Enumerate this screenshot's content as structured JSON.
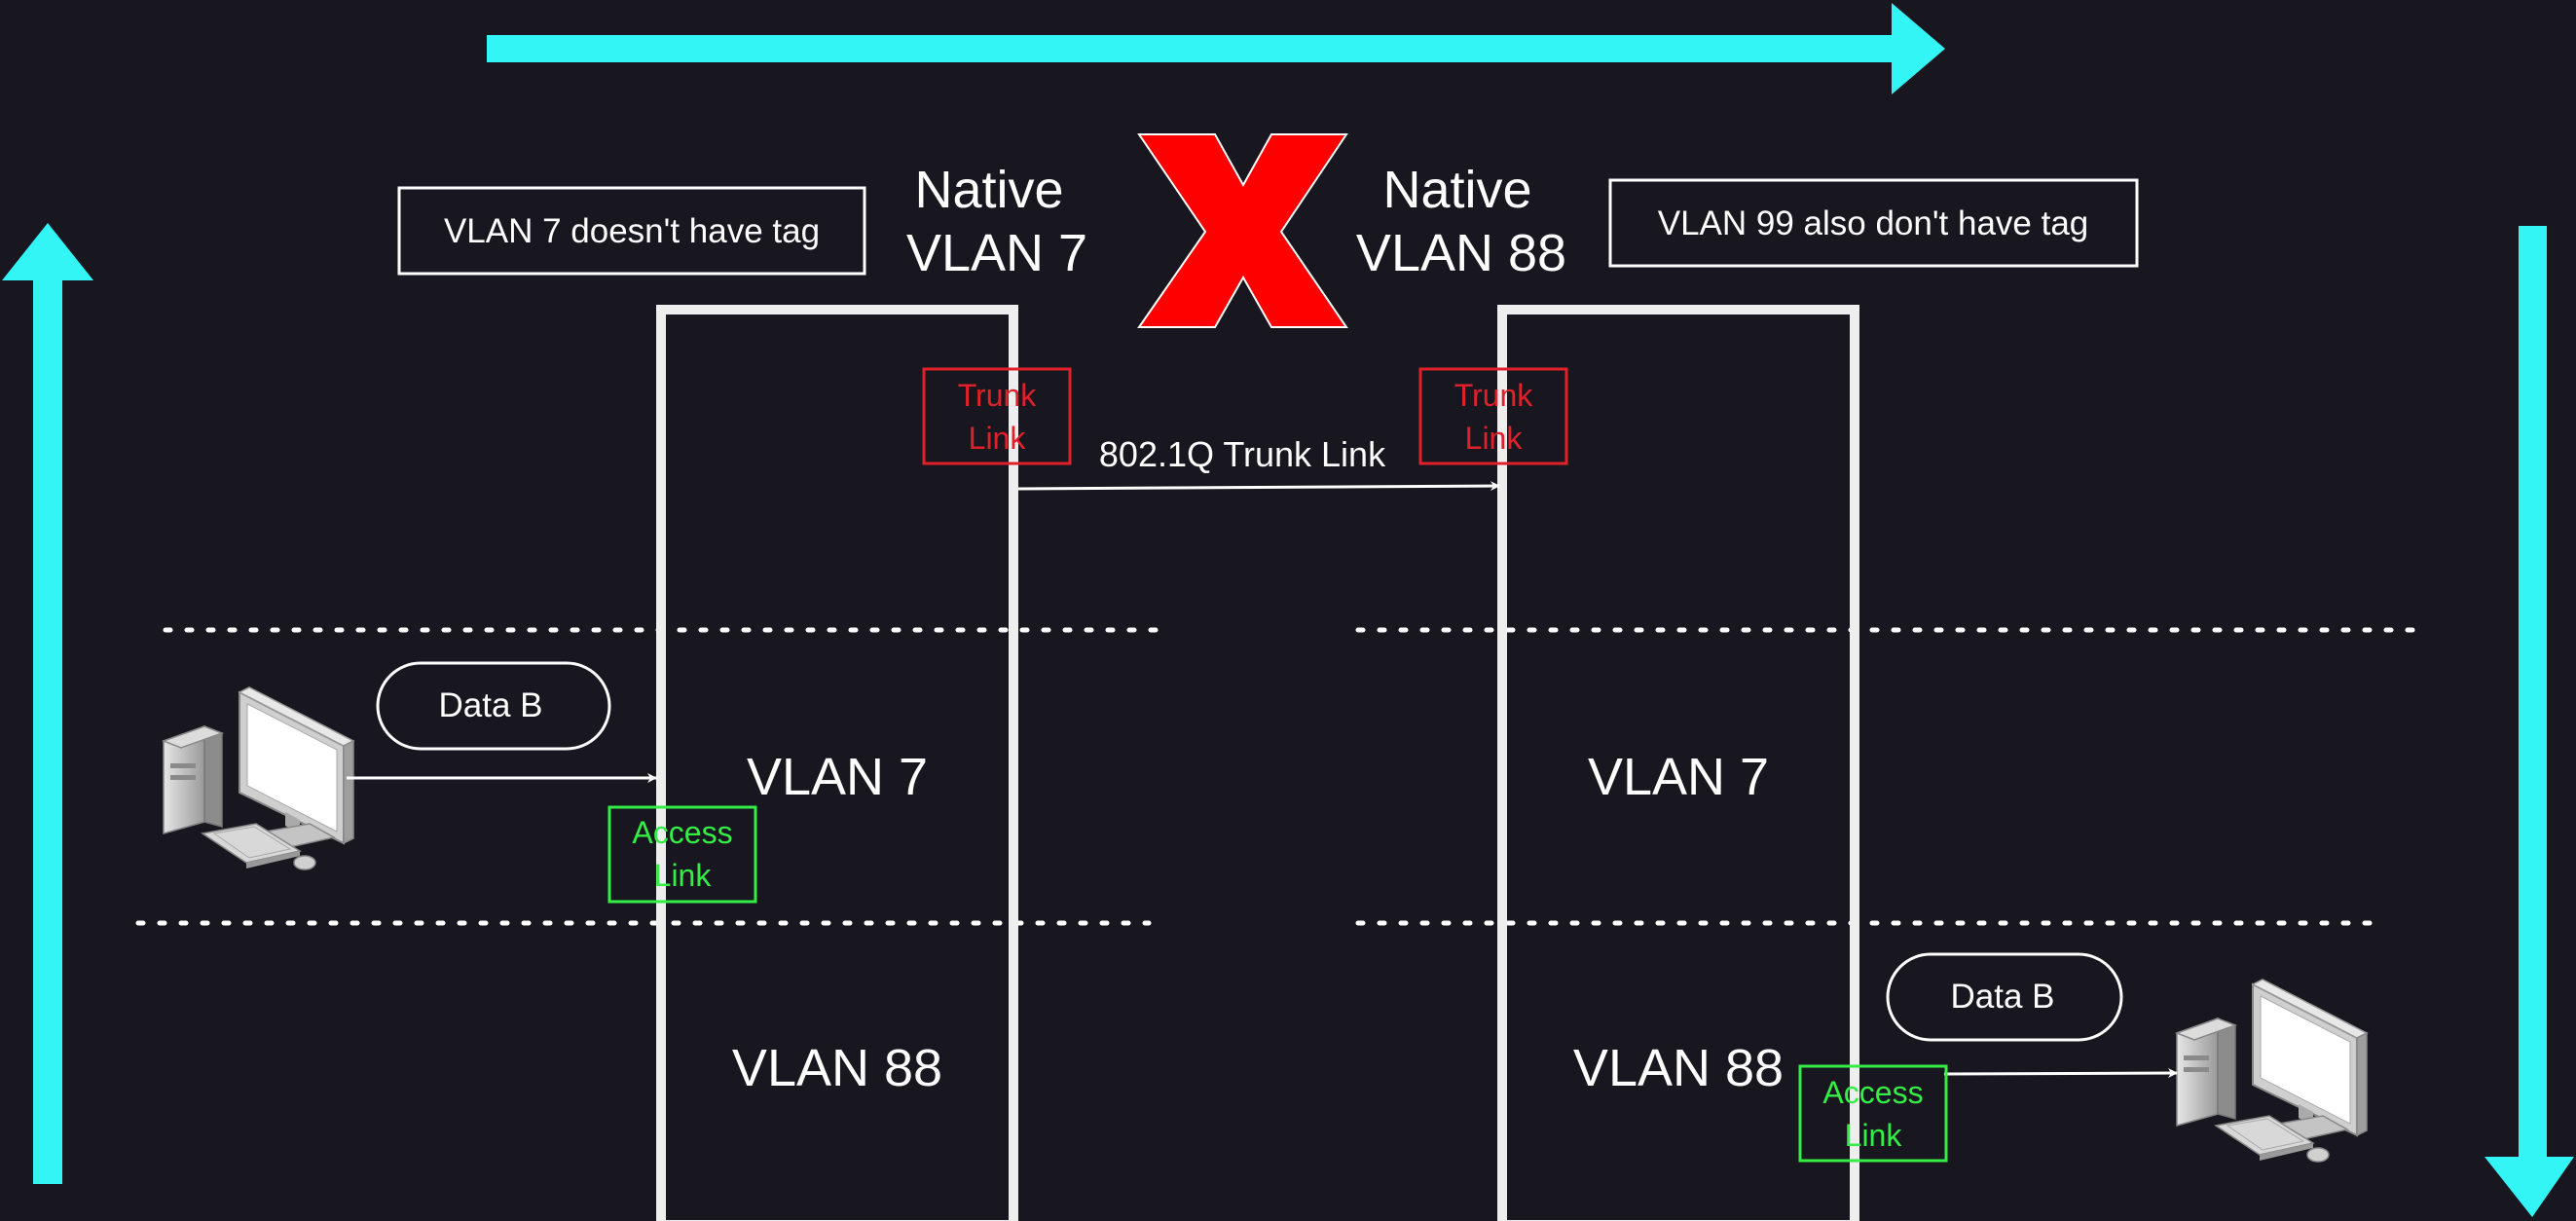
{
  "notes": {
    "left": "VLAN 7 doesn't have tag",
    "right": "VLAN 99 also don't have tag"
  },
  "native": {
    "left_line1": "Native",
    "left_line2": "VLAN 7",
    "right_line1": "Native",
    "right_line2": "VLAN 88"
  },
  "mismatch_symbol": "X",
  "trunk": {
    "left_line1": "Trunk",
    "left_line2": "Link",
    "right_line1": "Trunk",
    "right_line2": "Link",
    "link_label": "802.1Q Trunk Link"
  },
  "access": {
    "left_line1": "Access",
    "left_line2": "Link",
    "right_line1": "Access",
    "right_line2": "Link"
  },
  "data_bubbles": {
    "left": "Data B",
    "right": "Data B"
  },
  "switch_left": {
    "vlan_top": "VLAN 7",
    "vlan_bottom": "VLAN 88"
  },
  "switch_right": {
    "vlan_top": "VLAN 7",
    "vlan_bottom": "VLAN 88"
  },
  "colors": {
    "background": "#18171f",
    "flow_arrow": "#33f5f5",
    "mismatch": "#ff0000",
    "trunk_label": "#e0202a",
    "access_label": "#33ee44",
    "outline": "#ffffff",
    "switch_outline": "#eeeeee"
  },
  "icons": {
    "host_left": "desktop-computer-icon",
    "host_right": "desktop-computer-icon"
  }
}
